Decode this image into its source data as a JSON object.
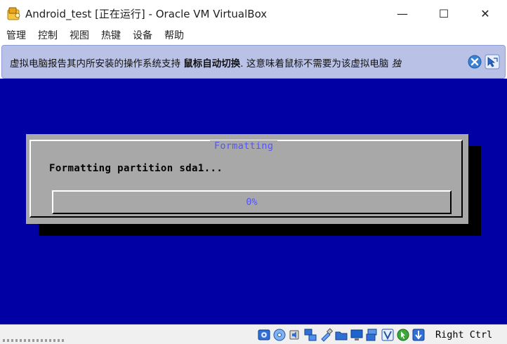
{
  "window": {
    "title": "Android_test [正在运行] - Oracle VM VirtualBox",
    "controls": {
      "minimize": "—",
      "maximize": "☐",
      "close": "✕"
    }
  },
  "menu": {
    "items": [
      "管理",
      "控制",
      "视图",
      "热键",
      "设备",
      "帮助"
    ]
  },
  "notification": {
    "text_before": "虚拟电脑报告其内所安装的操作系统支持 ",
    "bold": "鼠标自动切换",
    "text_after": ". 这意味着鼠标不需要为该虚拟电脑 ",
    "truncated_tail": "独"
  },
  "vm_dialog": {
    "title": "Formatting",
    "message": "Formatting partition sda1...",
    "progress_percent": 0,
    "progress_label": "0%"
  },
  "status_bar": {
    "icons": [
      "hard-disk-icon",
      "optical-disk-icon",
      "audio-icon",
      "network-icon",
      "usb-icon",
      "shared-folders-icon",
      "display-icon",
      "recording-icon",
      "virtualization-icon",
      "mouse-integration-icon",
      "keyboard-capture-icon"
    ],
    "host_key": "Right Ctrl"
  },
  "colors": {
    "vm_background": "#0000a4",
    "dialog_gray": "#a8a8a8",
    "dialog_accent": "#5454fc",
    "notice_background": "#b9c2e6"
  }
}
